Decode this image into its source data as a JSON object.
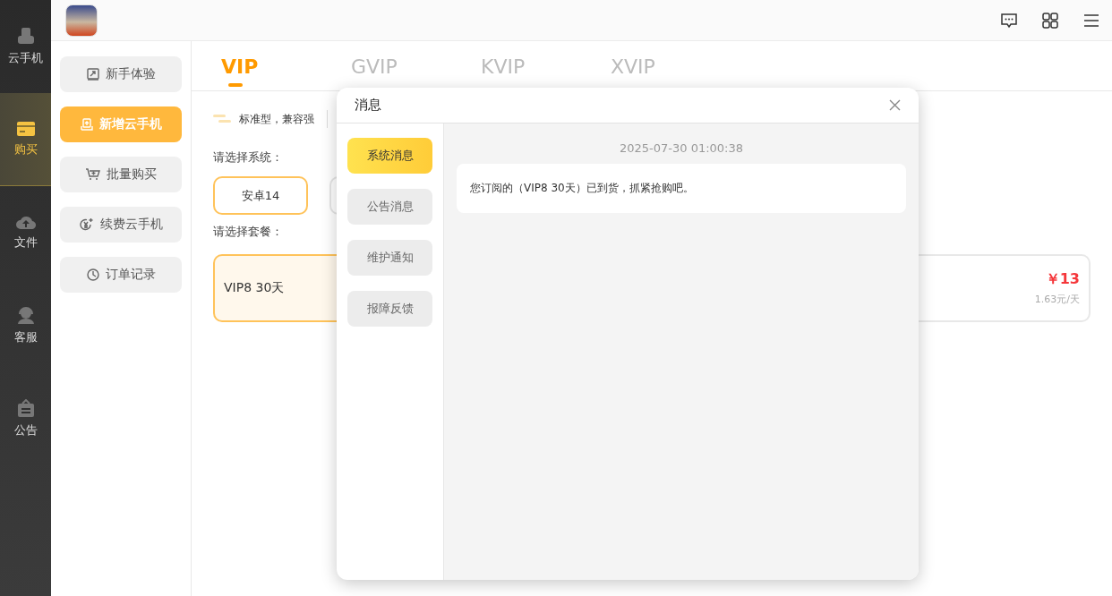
{
  "rail": {
    "items": [
      {
        "label": "云手机",
        "selected": false
      },
      {
        "label": "购买",
        "selected": true
      },
      {
        "label": "文件",
        "selected": false
      },
      {
        "label": "客服",
        "selected": false
      },
      {
        "label": "公告",
        "selected": false
      }
    ]
  },
  "menu": {
    "items": [
      {
        "label": "新手体验",
        "selected": false
      },
      {
        "label": "新增云手机",
        "selected": true
      },
      {
        "label": "批量购买",
        "selected": false
      },
      {
        "label": "续费云手机",
        "selected": false
      },
      {
        "label": "订单记录",
        "selected": false
      }
    ]
  },
  "tabs": [
    {
      "label": "VIP",
      "selected": true
    },
    {
      "label": "GVIP",
      "selected": false
    },
    {
      "label": "KVIP",
      "selected": false
    },
    {
      "label": "XVIP",
      "selected": false
    }
  ],
  "feature": {
    "text": "标准型，兼容强"
  },
  "system": {
    "prompt": "请选择系统：",
    "options": [
      {
        "label": "安卓14",
        "selected": true
      }
    ]
  },
  "packages": {
    "prompt": "请选择套餐：",
    "items": [
      {
        "name": "VIP8 30天",
        "selected": true
      },
      {
        "price": "￥13",
        "per_day": "1.63元/天",
        "selected": false
      }
    ]
  },
  "dialog": {
    "title": "消息",
    "categories": [
      {
        "label": "系统消息",
        "selected": true
      },
      {
        "label": "公告消息",
        "selected": false
      },
      {
        "label": "维护通知",
        "selected": false
      },
      {
        "label": "报障反馈",
        "selected": false
      }
    ],
    "messages": [
      {
        "time": "2025-07-30 01:00:38",
        "text": "您订阅的（VIP8 30天）已到货，抓紧抢购吧。"
      }
    ]
  }
}
